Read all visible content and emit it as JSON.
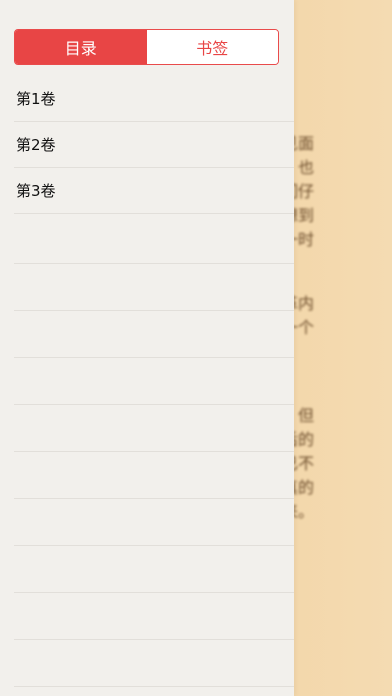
{
  "drawer": {
    "tabs": [
      {
        "label": "目录",
        "active": true
      },
      {
        "label": "书签",
        "active": false
      }
    ],
    "toc_items": [
      {
        "label": "第1卷"
      },
      {
        "label": "第2卷"
      },
      {
        "label": "第3卷"
      }
    ]
  },
  "reader": {
    "lines": [
      "友们见面",
      "想到，也",
      "编辑们仔",
      "但没想到",
      "行本一时",
      "，文革内",
      "却是一个",
      "。",
      "续集，但",
      "在其后的",
      "现但已不",
      "林云真的",
      "写下来。"
    ]
  },
  "colors": {
    "accent": "#e84545",
    "drawer_bg": "#f2f0ec",
    "reader_bg": "#f2d3a2"
  }
}
